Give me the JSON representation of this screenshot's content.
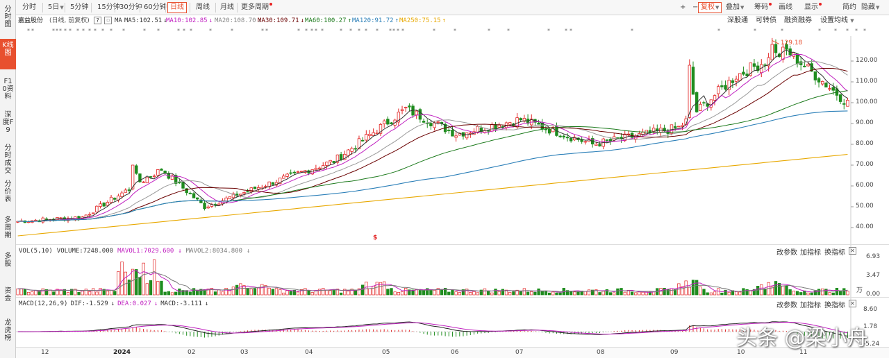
{
  "left_nav": [
    {
      "label": "分时图",
      "active": false
    },
    {
      "label": "K线图",
      "active": true
    },
    {
      "label": "F10资料",
      "active": false
    },
    {
      "label": "深度F9",
      "active": false
    },
    {
      "label": "分时成交",
      "active": false
    },
    {
      "label": "分价表",
      "active": false
    },
    {
      "label": "多周期",
      "active": false
    },
    {
      "label": "多股",
      "active": false
    },
    {
      "label": "资金",
      "active": false
    },
    {
      "label": "龙虎榜",
      "active": false
    }
  ],
  "toolbar": {
    "periods": [
      "分时",
      "5日",
      "5分钟",
      "15分钟",
      "30分钟",
      "60分钟",
      "日线",
      "周线",
      "月线",
      "更多周期"
    ],
    "active_period": "日线",
    "zoom_in": "+",
    "zoom_out": "−",
    "right_items": [
      "复权",
      "叠加",
      "筹码",
      "画线",
      "显示",
      "简约",
      "隐藏"
    ]
  },
  "info": {
    "stock_name": "嘉益股份",
    "adjust_mode": "(日线, 前复权)",
    "help": "?",
    "ma_label": "MA",
    "ma": [
      {
        "label": "MA5:102.51",
        "arrow": "↓",
        "color": "#333333"
      },
      {
        "label": "MA10:102.85",
        "arrow": "↓",
        "color": "#c020c0"
      },
      {
        "label": "MA20:108.70",
        "arrow": "↓",
        "color": "#888888"
      },
      {
        "label": "MA30:109.71",
        "arrow": "↓",
        "color": "#6a0000"
      },
      {
        "label": "MA60:100.27",
        "arrow": "↑",
        "color": "#1c7a1c"
      },
      {
        "label": "MA120:91.72",
        "arrow": "↑",
        "color": "#2b7fb8"
      },
      {
        "label": "MA250:75.15",
        "arrow": "↑",
        "color": "#e8a800"
      }
    ],
    "right_links": [
      "深股通",
      "可转债",
      "融资融券",
      "设置均线"
    ]
  },
  "markers": {
    "symbol": "*",
    "special": "$"
  },
  "colors": {
    "up": "#e22222",
    "down": "#1f8c1f",
    "accent": "#e8502f"
  },
  "price_axis": [
    "120.00",
    "110.00",
    "100.00",
    "90.00",
    "80.00",
    "70.00",
    "60.00",
    "50.00",
    "40.00"
  ],
  "peak_label": "129.18",
  "volume_panel": {
    "title": "VOL(5,10)",
    "volume": "VOLUME:7248.000",
    "mavol1": "MAVOL1:7029.600",
    "mavol1_arrow": "↓",
    "mavol2": "MAVOL2:8034.800",
    "mavol2_arrow": "↓",
    "axis": [
      "6.93",
      "3.47",
      "0.00"
    ],
    "axis_unit": "万",
    "buttons": [
      "改参数",
      "加指标",
      "换指标"
    ]
  },
  "macd_panel": {
    "title": "MACD(12,26,9)",
    "dif": "DIF:-1.529",
    "dif_arrow": "↓",
    "dea": "DEA:0.027",
    "dea_arrow": "↓",
    "macd": "MACD:-3.111",
    "macd_arrow": "↓",
    "axis": [
      "8.60",
      "1.78",
      "-5.24"
    ],
    "buttons": [
      "改参数",
      "加指标",
      "换指标"
    ]
  },
  "date_axis": [
    "12",
    "2024",
    "02",
    "03",
    "04",
    "05",
    "06",
    "07",
    "08",
    "09",
    "10",
    "11"
  ],
  "watermark": "头条 @梁小舟",
  "chart_data": {
    "type": "candlestick",
    "title": "嘉益股份",
    "ylim": [
      33,
      131
    ],
    "peak": 129.18,
    "key_closes": [
      {
        "date": "12",
        "close": 43
      },
      {
        "date": "2024-01",
        "close": 45
      },
      {
        "date": "2024-01-late",
        "close": 68
      },
      {
        "date": "02",
        "close": 50
      },
      {
        "date": "03",
        "close": 60
      },
      {
        "date": "04",
        "close": 72
      },
      {
        "date": "05",
        "close": 97
      },
      {
        "date": "06",
        "close": 85
      },
      {
        "date": "07",
        "close": 92
      },
      {
        "date": "08",
        "close": 80
      },
      {
        "date": "09",
        "close": 88
      },
      {
        "date": "10",
        "close": 113
      },
      {
        "date": "11",
        "close": 125
      },
      {
        "date": "last",
        "close": 100
      }
    ],
    "series": [
      {
        "name": "MA5",
        "last": 102.51
      },
      {
        "name": "MA10",
        "last": 102.85
      },
      {
        "name": "MA20",
        "last": 108.7
      },
      {
        "name": "MA30",
        "last": 109.71
      },
      {
        "name": "MA60",
        "last": 100.27
      },
      {
        "name": "MA120",
        "last": 91.72
      },
      {
        "name": "MA250",
        "last": 75.15
      }
    ],
    "volume_ylim": [
      0,
      6.93
    ],
    "macd_ylim": [
      -5.24,
      8.6
    ]
  }
}
